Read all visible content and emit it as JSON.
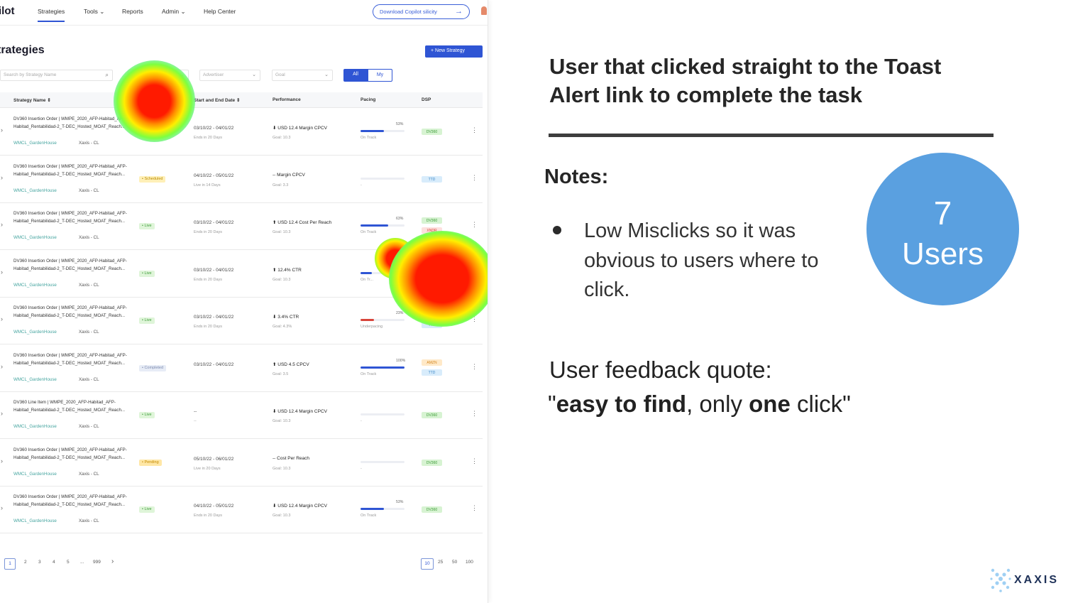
{
  "app": {
    "brand": "ilot",
    "nav": [
      "Strategies",
      "Tools",
      "Reports",
      "Admin",
      "Help Center"
    ],
    "download_label": "Download  Copilot silicity",
    "page_title": "trategies",
    "new_strategy_label": "+ New Strategy",
    "filters": {
      "search_placeholder": "Search by Strategy Name",
      "market": "Market",
      "advertiser": "Advertiser",
      "goal": "Goal",
      "toggle_all": "All",
      "toggle_my": "My"
    },
    "columns": [
      "Strategy Name",
      "Start and End Date",
      "Performance",
      "Pacing",
      "DSP"
    ],
    "rows": [
      {
        "name": "DV360 Insertion Order | WMPE_2020_AFP-Habitad_AFP-Habitad_Rentabilidad-2_T-DEC_Hosted_MOAT_Reach...",
        "sub1": "WMCL_GardenHouse",
        "sub2": "Xaxis - CL",
        "status": "• Live",
        "status_class": "st-live",
        "dates": "03/10/22 - 04/01/22",
        "date_sub": "Ends in 20 Days",
        "perf": "⬇ USD 12.4 Margin CPCV",
        "goal": "Goal: 10.3",
        "pacing_pct": "53%",
        "pacing_fill": 0.53,
        "pacing_color": "#2f55d4",
        "pacing_label": "On Track",
        "dsp": [
          "DV360"
        ],
        "dsp_class": [
          "dsp-dv"
        ]
      },
      {
        "name": "DV360 Insertion Order | WMPE_2020_AFP-Habitad_AFP-Habitad_Rentabilidad-2_T-DEC_Hosted_MOAT_Reach...",
        "sub1": "WMCL_GardenHouse",
        "sub2": "Xaxis - CL",
        "status": "• Scheduled",
        "status_class": "st-sched",
        "dates": "04/10/22 - 05/01/22",
        "date_sub": "Live in 14 Days",
        "perf": "-- Margin CPCV",
        "goal": "Goal: 3.3",
        "pacing_pct": "",
        "pacing_fill": 0,
        "pacing_color": "#2f55d4",
        "pacing_label": "-",
        "dsp": [
          "TTD"
        ],
        "dsp_class": [
          "dsp-ttd"
        ]
      },
      {
        "name": "DV360 Insertion Order | WMPE_2020_AFP-Habitad_AFP-Habitad_Rentabilidad-2_T-DEC_Hosted_MOAT_Reach...",
        "sub1": "WMCL_GardenHouse",
        "sub2": "Xaxis - CL",
        "status": "• Live",
        "status_class": "st-live",
        "dates": "03/10/22 - 04/01/22",
        "date_sub": "Ends in 20 Days",
        "perf": "⬆ USD 12.4 Cost Per Reach",
        "goal": "Goal: 10.3",
        "pacing_pct": "63%",
        "pacing_fill": 0.63,
        "pacing_color": "#2f55d4",
        "pacing_label": "On Track",
        "dsp": [
          "DV360",
          "XNDR"
        ],
        "dsp_class": [
          "dsp-dv",
          "dsp-xndr"
        ]
      },
      {
        "name": "DV360 Insertion Order | WMPE_2020_AFP-Habitad_AFP-Habitad_Rentabilidad-2_T-DEC_Hosted_MOAT_Reach...",
        "sub1": "WMCL_GardenHouse",
        "sub2": "Xaxis - CL",
        "status": "• Live",
        "status_class": "st-live",
        "dates": "03/10/22 - 04/01/22",
        "date_sub": "Ends in 20 Days",
        "perf": "⬆ 12.4% CTR",
        "goal": "Goal: 10.3",
        "pacing_pct": "",
        "pacing_fill": 0.25,
        "pacing_color": "#2f55d4",
        "pacing_label": "On Tr...",
        "dsp": [],
        "dsp_class": []
      },
      {
        "name": "DV360 Insertion Order | WMPE_2020_AFP-Habitad_AFP-Habitad_Rentabilidad-2_T-DEC_Hosted_MOAT_Reach...",
        "sub1": "WMCL_GardenHouse",
        "sub2": "Xaxis - CL",
        "status": "• Live",
        "status_class": "st-live",
        "dates": "03/10/22 - 04/01/22",
        "date_sub": "Ends in 20 Days",
        "perf": "⬇ 3.4% CTR",
        "goal": "Goal: 4.3%",
        "pacing_pct": "23%",
        "pacing_fill": 0.3,
        "pacing_color": "#d7443a",
        "pacing_label": "Underpacing",
        "dsp": [
          "DV360",
          "TTD"
        ],
        "dsp_class": [
          "dsp-dv",
          "dsp-ttd"
        ]
      },
      {
        "name": "DV360 Insertion Order | WMPE_2020_AFP-Habitad_AFP-Habitad_Rentabilidad-2_T-DEC_Hosted_MOAT_Reach...",
        "sub1": "WMCL_GardenHouse",
        "sub2": "Xaxis - CL",
        "status": "• Completed",
        "status_class": "st-comp",
        "dates": "03/10/22 - 04/01/22",
        "date_sub": "",
        "perf": "⬆ USD 4.5 CPCV",
        "goal": "Goal: 3.5",
        "pacing_pct": "100%",
        "pacing_fill": 1,
        "pacing_color": "#2f55d4",
        "pacing_label": "On Track",
        "dsp": [
          "AMZN",
          "TTD"
        ],
        "dsp_class": [
          "dsp-amzn",
          "dsp-ttd"
        ]
      },
      {
        "name": "DV360 Line Item | WMPE_2020_AFP-Habitad_AFP-Habitad_Rentabilidad-2_T-DEC_Hosted_MOAT_Reach...",
        "sub1": "WMCL_GardenHouse",
        "sub2": "Xaxis - CL",
        "status": "• Live",
        "status_class": "st-live",
        "dates": "--",
        "date_sub": "--",
        "perf": "⬇ USD 12.4 Margin CPCV",
        "goal": "Goal: 10.3",
        "pacing_pct": "",
        "pacing_fill": 0,
        "pacing_color": "#2f55d4",
        "pacing_label": "-",
        "dsp": [
          "DV360"
        ],
        "dsp_class": [
          "dsp-dv"
        ]
      },
      {
        "name": "DV360 Insertion Order | WMPE_2020_AFP-Habitad_AFP-Habitad_Rentabilidad-2_T-DEC_Hosted_MOAT_Reach...",
        "sub1": "WMCL_GardenHouse",
        "sub2": "Xaxis - CL",
        "status": "• Pending",
        "status_class": "st-pend",
        "dates": "05/10/22 - 06/01/22",
        "date_sub": "Live in 20 Days",
        "perf": "-- Cost Per Reach",
        "goal": "Goal: 10.3",
        "pacing_pct": "",
        "pacing_fill": 0,
        "pacing_color": "#2f55d4",
        "pacing_label": "-",
        "dsp": [
          "DV360"
        ],
        "dsp_class": [
          "dsp-dv"
        ]
      },
      {
        "name": "DV360 Insertion Order | WMPE_2020_AFP-Habitad_AFP-Habitad_Rentabilidad-2_T-DEC_Hosted_MOAT_Reach...",
        "sub1": "WMCL_GardenHouse",
        "sub2": "Xaxis - CL",
        "status": "• Live",
        "status_class": "st-live",
        "dates": "04/10/22 - 05/01/22",
        "date_sub": "Ends in 20 Days",
        "perf": "⬇ USD 12.4 Margin CPCV",
        "goal": "Goal: 10.3",
        "pacing_pct": "53%",
        "pacing_fill": 0.53,
        "pacing_color": "#2f55d4",
        "pacing_label": "On Track",
        "dsp": [
          "DV360"
        ],
        "dsp_class": [
          "dsp-dv"
        ]
      }
    ],
    "pager": {
      "pages": [
        "1",
        "2",
        "3",
        "4",
        "5",
        "...",
        "999",
        "›"
      ],
      "sizes": [
        "10",
        "25",
        "50",
        "100"
      ]
    }
  },
  "slide": {
    "heading": "User that clicked straight to the Toast Alert link to complete the task",
    "notes_label": "Notes:",
    "bullet": "Low Misclicks so it was obvious to users where to click.",
    "user_count": "7",
    "users_label": "Users",
    "feedback_label": "User feedback quote:",
    "quote_open": "\"",
    "quote_bold1": "easy to find",
    "quote_mid": ", only ",
    "quote_bold2": "one",
    "quote_end": " click\"",
    "logo_text": "XAXIS"
  },
  "colors": {
    "accent": "#2f55d4",
    "circle": "#5aa0e0",
    "logo": "#1e3158"
  }
}
